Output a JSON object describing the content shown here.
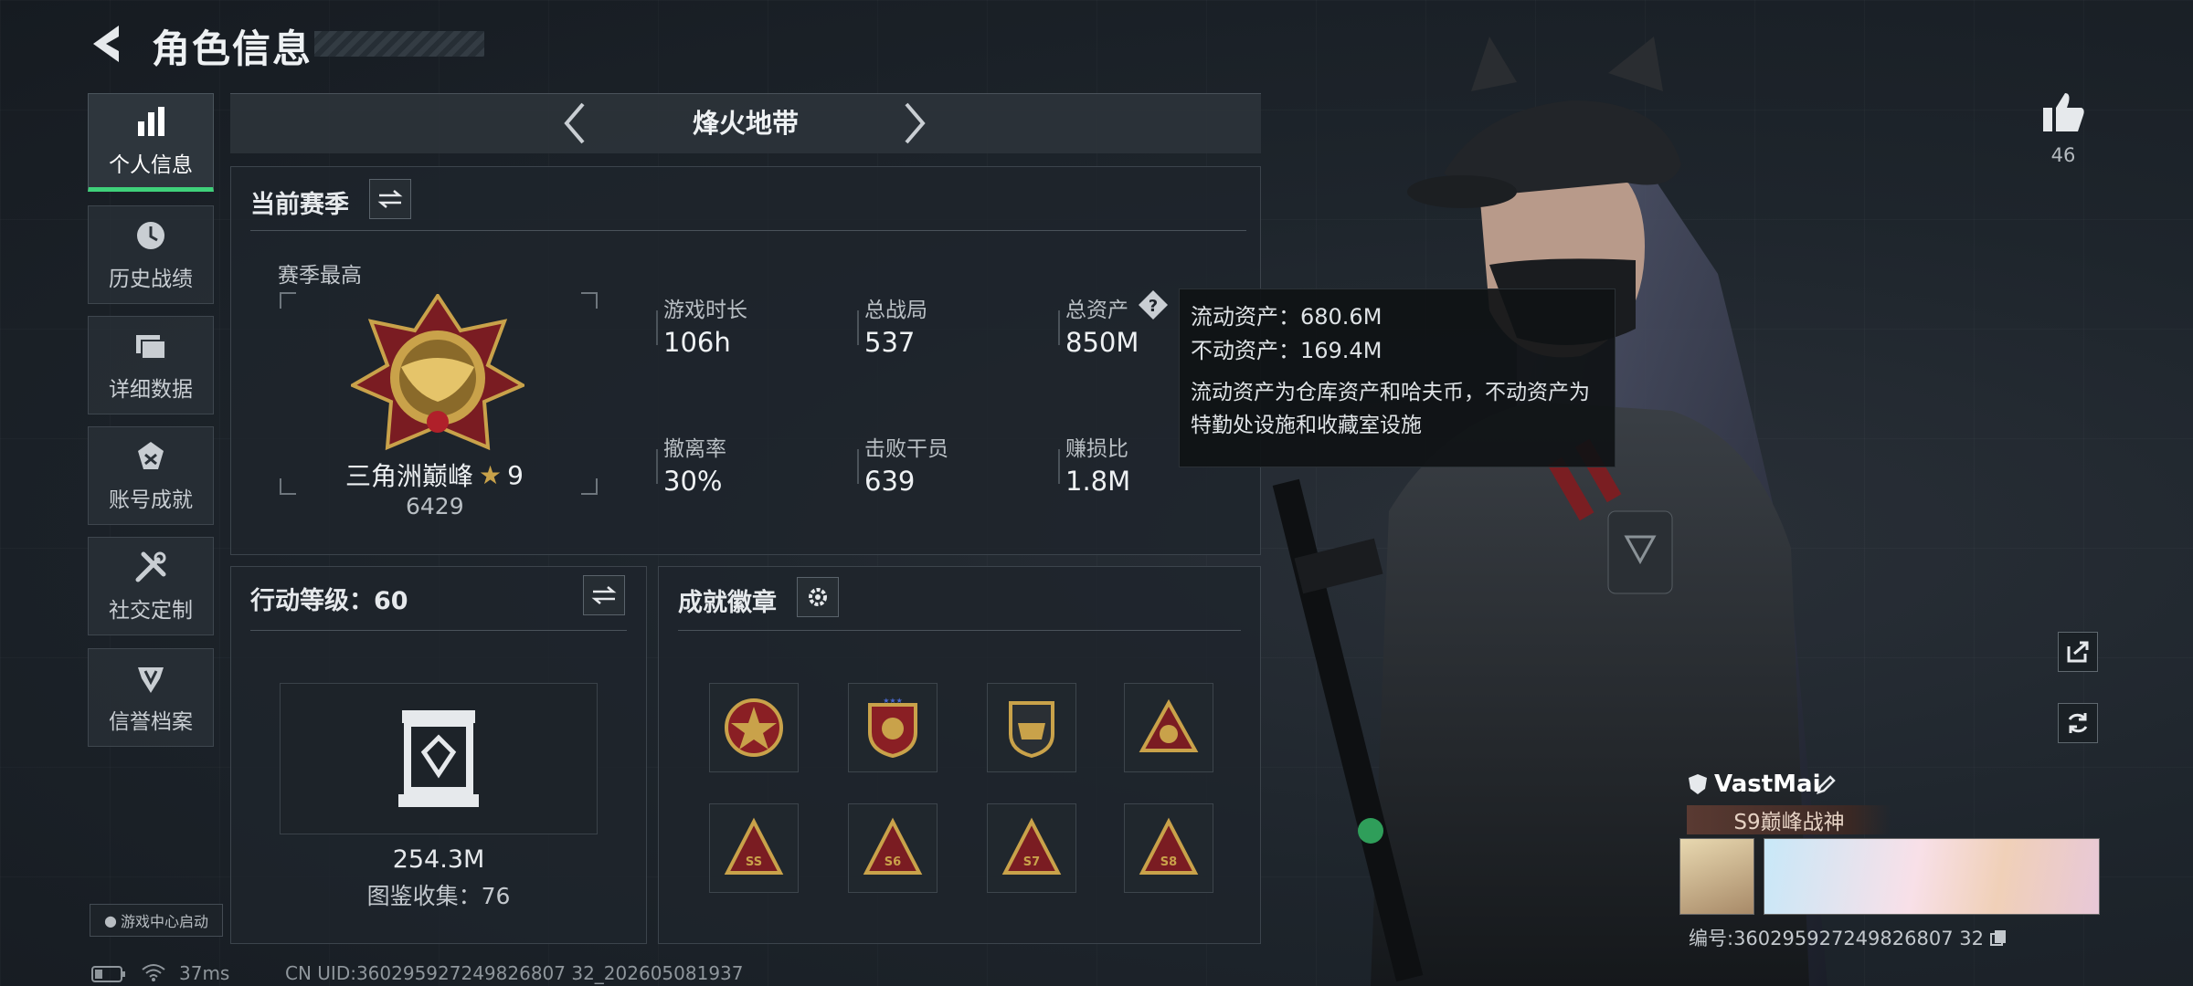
{
  "header": {
    "title": "角色信息"
  },
  "sidebar": {
    "items": [
      {
        "label": "个人信息",
        "icon": "bar-chart-icon",
        "active": true
      },
      {
        "label": "历史战绩",
        "icon": "clock-icon"
      },
      {
        "label": "详细数据",
        "icon": "folder-icon"
      },
      {
        "label": "账号成就",
        "icon": "achievement-icon"
      },
      {
        "label": "社交定制",
        "icon": "tools-icon"
      },
      {
        "label": "信誉档案",
        "icon": "shield-icon"
      }
    ],
    "game_center": "游戏中心启动"
  },
  "mode": {
    "name": "烽火地带"
  },
  "season": {
    "title": "当前赛季",
    "best_label": "赛季最高",
    "rank_name": "三角洲巅峰",
    "rank_stars": "9",
    "rank_score": "6429",
    "stats": [
      {
        "label": "游戏时长",
        "value": "106h"
      },
      {
        "label": "总战局",
        "value": "537"
      },
      {
        "label": "总资产",
        "value": "850M"
      },
      {
        "label": "撤离率",
        "value": "30%"
      },
      {
        "label": "击败干员",
        "value": "639"
      },
      {
        "label": "赚损比",
        "value": "1.8M"
      }
    ]
  },
  "tooltip": {
    "line1": "流动资产：680.6M",
    "line2": "不动资产：169.4M",
    "note": "流动资产为仓库资产和哈夫币，不动资产为特勤处设施和收藏室设施"
  },
  "action_level": {
    "title": "行动等级：60",
    "value": "254.3M",
    "collection": "图鉴收集：76"
  },
  "achievements": {
    "title": "成就徽章",
    "badges": [
      "SS",
      "S6",
      "S7",
      "S8"
    ]
  },
  "profile": {
    "name": "VastMai",
    "title": "S9巅峰战神",
    "id": "编号:360295927249826807 32",
    "likes": "46"
  },
  "status": {
    "ping": "37ms",
    "uid": "CN UID:360295927249826807 32_202605081937"
  },
  "colors": {
    "accent": "#3fd17a",
    "gold": "#c9a24a"
  }
}
